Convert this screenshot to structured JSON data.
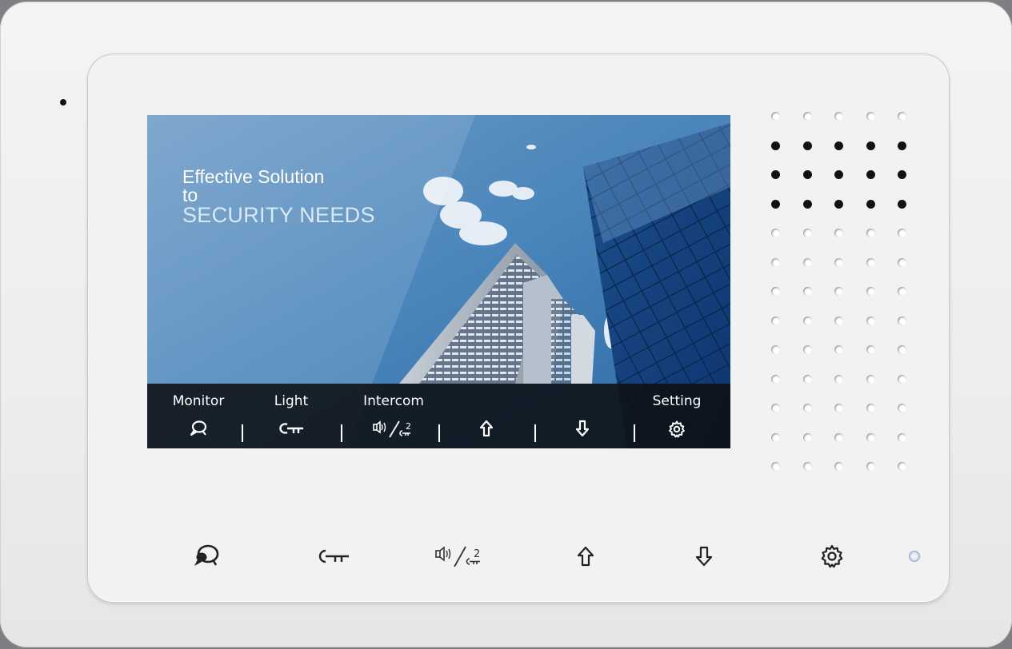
{
  "screen": {
    "headline_line1": "Effective Solution",
    "headline_line2": "to",
    "headline_line3": "SECURITY NEEDS"
  },
  "softkeys": [
    {
      "label": "Monitor",
      "icon": "monitor-icon"
    },
    {
      "label": "Light",
      "icon": "key-icon"
    },
    {
      "label": "Intercom",
      "icon": "intercom-icon"
    },
    {
      "label": "",
      "icon": "arrow-up-icon"
    },
    {
      "label": "",
      "icon": "arrow-down-icon"
    },
    {
      "label": "Setting",
      "icon": "gear-icon"
    }
  ],
  "hardware_buttons": [
    {
      "icon": "monitor-icon"
    },
    {
      "icon": "key-icon"
    },
    {
      "icon": "intercom-icon"
    },
    {
      "icon": "arrow-up-icon"
    },
    {
      "icon": "arrow-down-icon"
    },
    {
      "icon": "gear-icon"
    }
  ],
  "intercom_icon_digit": "2",
  "colors": {
    "device": "#f2f2f2",
    "screen_sky": "#4f82b3",
    "softbar": "#0c1014",
    "icon_dark": "#222222"
  }
}
